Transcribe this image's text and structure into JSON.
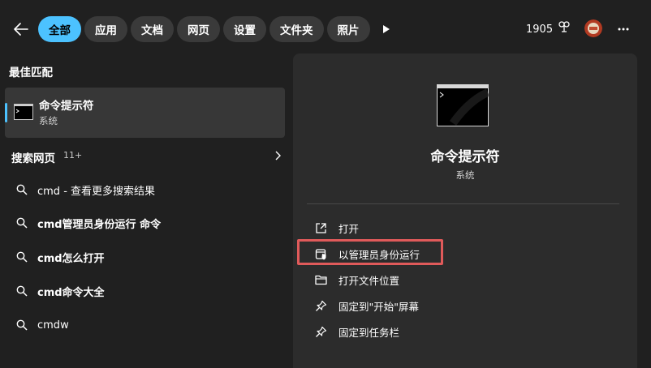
{
  "filters": [
    "全部",
    "应用",
    "文档",
    "网页",
    "设置",
    "文件夹",
    "照片"
  ],
  "points": "1905",
  "best_match": {
    "section_title": "最佳匹配",
    "name": "命令提示符",
    "sub": "系统"
  },
  "web": {
    "section_title": "搜索网页",
    "count": "11+",
    "results": [
      {
        "label": "cmd - 查看更多搜索结果"
      },
      {
        "label": "cmd管理员身份运行 命令"
      },
      {
        "label": "cmd怎么打开"
      },
      {
        "label": "cmd命令大全"
      },
      {
        "label": "cmdw"
      }
    ]
  },
  "preview": {
    "title": "命令提示符",
    "sub": "系统",
    "actions": [
      {
        "label": "打开",
        "icon": "open-external-icon"
      },
      {
        "label": "以管理员身份运行",
        "icon": "shield-admin-icon"
      },
      {
        "label": "打开文件位置",
        "icon": "folder-icon"
      },
      {
        "label": "固定到\"开始\"屏幕",
        "icon": "pin-icon"
      },
      {
        "label": "固定到任务栏",
        "icon": "pin-icon"
      }
    ]
  },
  "colors": {
    "accent": "#4cc2ff",
    "highlight": "#e05a5a",
    "background": "#202020",
    "panel": "#2c2c2c"
  }
}
